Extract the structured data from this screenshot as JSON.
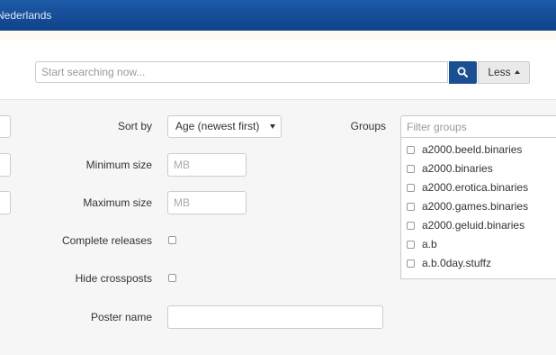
{
  "header": {
    "language": "Nederlands"
  },
  "search": {
    "placeholder": "Start searching now...",
    "less_label": "Less"
  },
  "filters": {
    "sort_label": "Sort by",
    "sort_value": "Age (newest first)",
    "min_size_label": "Minimum size",
    "min_size_placeholder": "MB",
    "max_size_label": "Maximum size",
    "max_size_placeholder": "MB",
    "complete_label": "Complete releases",
    "crossposts_label": "Hide crossposts",
    "poster_label": "Poster name",
    "poster_value": ""
  },
  "groups": {
    "label": "Groups",
    "placeholder": "Filter groups",
    "items": [
      "a2000.beeld.binaries",
      "a2000.binaries",
      "a2000.erotica.binaries",
      "a2000.games.binaries",
      "a2000.geluid.binaries",
      "a.b",
      "a.b.0day.stuffz"
    ]
  },
  "icons": {
    "search": "search-icon",
    "caret": "caret-up-icon"
  },
  "colors": {
    "header": "#14498f",
    "search_button": "#1a4f93",
    "panel": "#f6f6f6"
  }
}
